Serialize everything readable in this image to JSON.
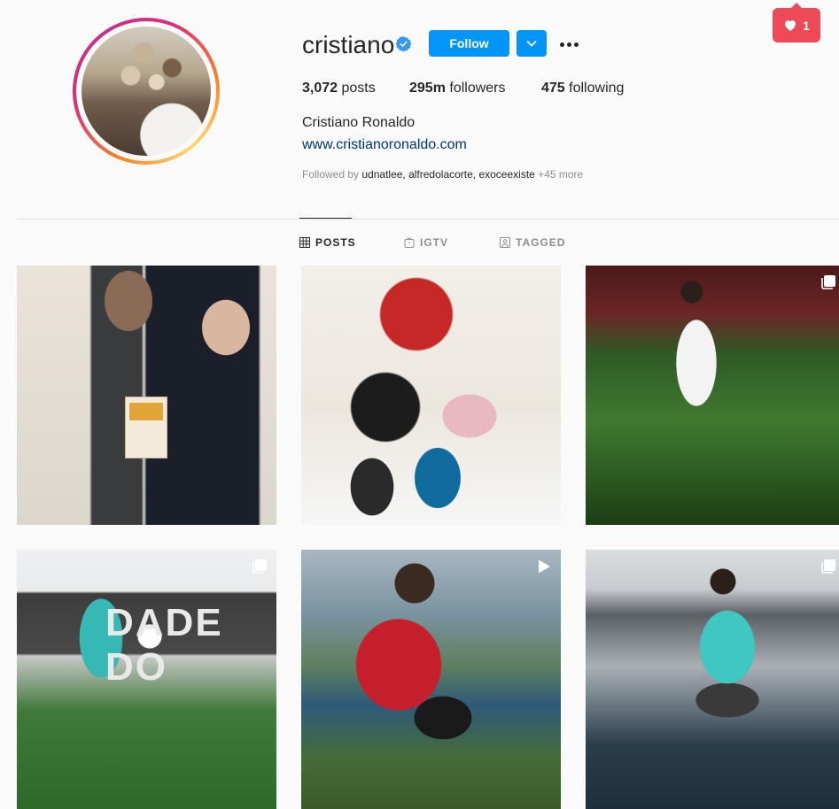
{
  "notification": {
    "icon": "heart-icon",
    "count": "1",
    "color": "#ed4956"
  },
  "profile": {
    "username": "cristiano",
    "verified": true,
    "follow_label": "Follow",
    "stats": {
      "posts_count": "3,072",
      "posts_label": "posts",
      "followers_count": "295m",
      "followers_label": "followers",
      "following_count": "475",
      "following_label": "following"
    },
    "full_name": "Cristiano Ronaldo",
    "website": "www.cristianoronaldo.com",
    "followed_by_prefix": "Followed by",
    "followed_by_names": "udnatlee, alfredolacorte, exoceexiste",
    "followed_by_more": "+45 more"
  },
  "tabs": [
    {
      "label": "POSTS",
      "icon": "grid-icon",
      "active": true
    },
    {
      "label": "IGTV",
      "icon": "igtv-icon",
      "active": false
    },
    {
      "label": "TAGGED",
      "icon": "tag-icon",
      "active": false
    }
  ],
  "posts": [
    {
      "type": "photo"
    },
    {
      "type": "photo"
    },
    {
      "type": "carousel",
      "icon": "carousel-icon"
    },
    {
      "type": "carousel",
      "icon": "carousel-icon",
      "wall_text": "DADE DO"
    },
    {
      "type": "video",
      "icon": "video-icon"
    },
    {
      "type": "carousel",
      "icon": "carousel-icon"
    }
  ],
  "colors": {
    "accent": "#0095f6",
    "link": "#00376b",
    "text": "#262626",
    "muted": "#8e8e8e",
    "divider": "#dbdbdb"
  }
}
